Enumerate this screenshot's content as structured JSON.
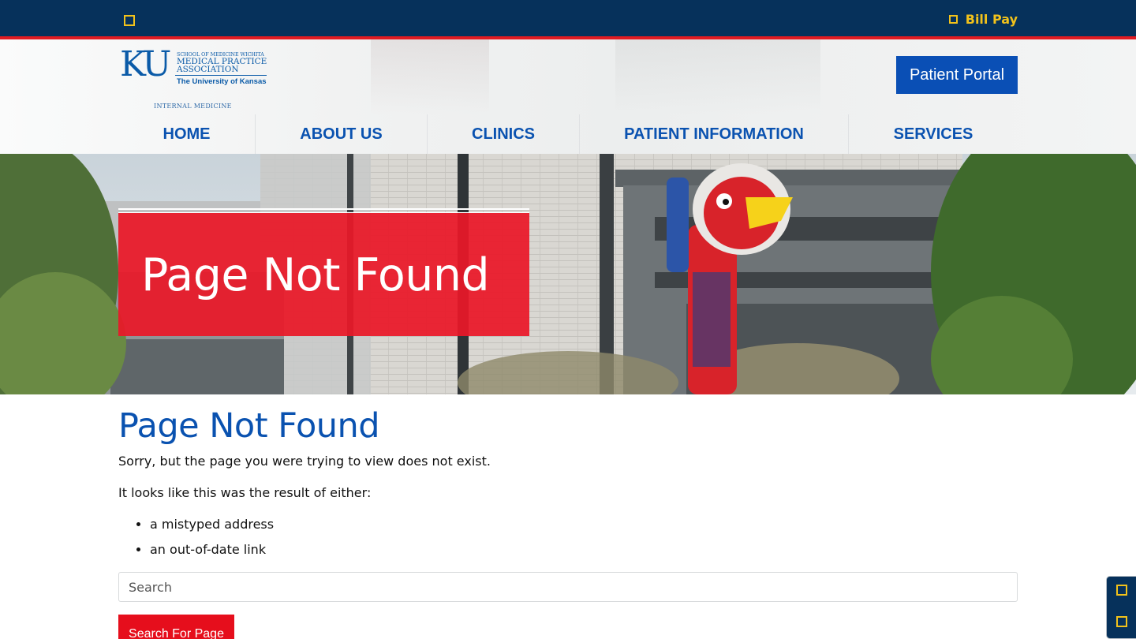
{
  "colors": {
    "navy": "#06315b",
    "red_accent": "#e01b22",
    "gold": "#f2c21b",
    "brand_blue": "#0a52b0",
    "banner_red": "#ea1828",
    "button_red": "#e60e1c"
  },
  "topbar": {
    "left_icon": "square-icon",
    "billpay_icon": "square-icon",
    "billpay_label": "Bill Pay"
  },
  "logo": {
    "ku": "KU",
    "school_line": "SCHOOL OF MEDICINE WICHITA",
    "org_line1": "MEDICAL PRACTICE",
    "org_line2": "ASSOCIATION",
    "university": "The University of Kansas",
    "department": "INTERNAL MEDICINE"
  },
  "header": {
    "portal_label": "Patient Portal"
  },
  "nav": {
    "items": [
      {
        "label": "HOME"
      },
      {
        "label": "ABOUT US"
      },
      {
        "label": "CLINICS"
      },
      {
        "label": "PATIENT INFORMATION"
      },
      {
        "label": "SERVICES"
      }
    ]
  },
  "hero": {
    "banner_title": "Page Not Found"
  },
  "main": {
    "heading": "Page Not Found",
    "message": "Sorry, but the page you were trying to view does not exist.",
    "reason_intro": "It looks like this was the result of either:",
    "reasons": [
      "a mistyped address",
      "an out-of-date link"
    ],
    "search_placeholder": "Search",
    "search_button": "Search For Page"
  },
  "widget": {
    "icons": [
      "square-icon",
      "square-icon"
    ]
  }
}
